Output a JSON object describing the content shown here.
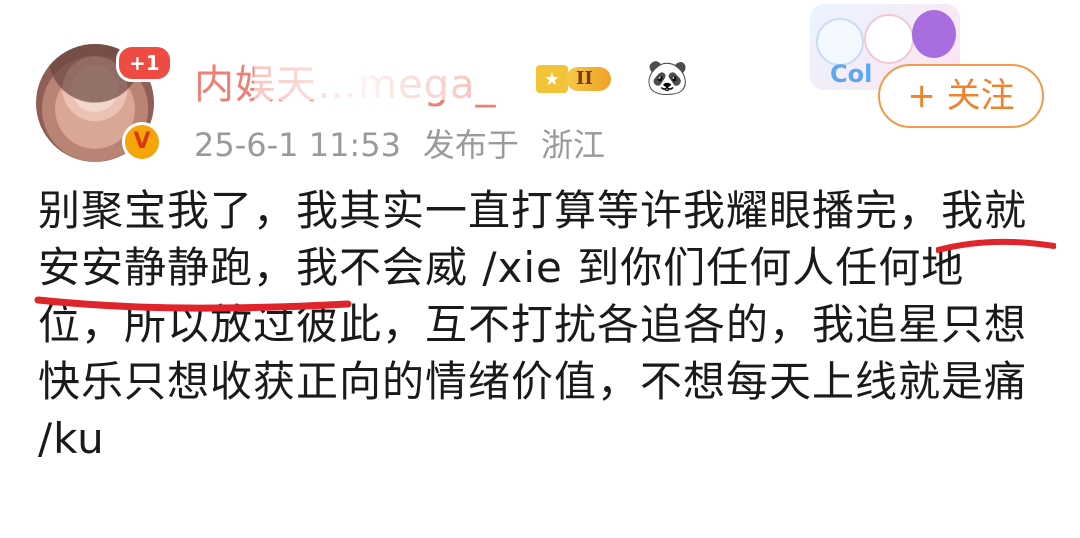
{
  "user": {
    "badge_count": "+1",
    "verified_icon": "v-badge-icon",
    "name_visible": "内娱天…mega_",
    "level_label": "II",
    "emoji": "panda-face"
  },
  "meta": {
    "time": "25-6-1 11:53",
    "published_label": "发布于",
    "location": "浙江"
  },
  "follow": {
    "label": "+ 关注"
  },
  "post": {
    "text": "别聚宝我了，我其实一直打算等许我耀眼播完，我就安安静静跑，我不会威 /xie 到你们任何人任何地位，所以放过彼此，互不打扰各追各的，我追星只想快乐只想收获正向的情绪价值，不想每天上线就是痛 /ku"
  },
  "sticker": {
    "text": "Col"
  },
  "colors": {
    "username": "#f07f73",
    "follow": "#f0822b",
    "underline": "#e0242b"
  }
}
